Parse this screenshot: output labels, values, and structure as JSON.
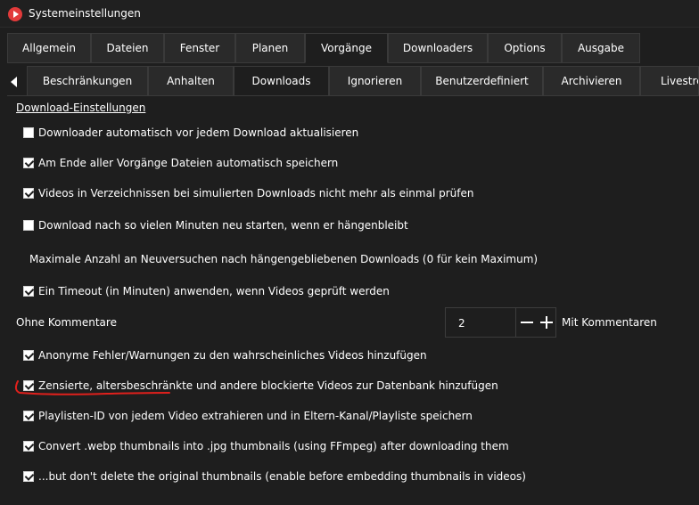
{
  "window": {
    "title": "Systemeinstellungen",
    "icon": "app-play-icon"
  },
  "main_tabs": [
    {
      "label": "Allgemein"
    },
    {
      "label": "Dateien"
    },
    {
      "label": "Fenster"
    },
    {
      "label": "Planen"
    },
    {
      "label": "Vorgänge",
      "active": true
    },
    {
      "label": "Downloaders"
    },
    {
      "label": "Options"
    },
    {
      "label": "Ausgabe"
    }
  ],
  "sub_tabs": [
    {
      "label": "Beschränkungen"
    },
    {
      "label": "Anhalten"
    },
    {
      "label": "Downloads",
      "active": true
    },
    {
      "label": "Ignorieren"
    },
    {
      "label": "Benutzerdefiniert"
    },
    {
      "label": "Archivieren"
    },
    {
      "label": "Livestrea"
    }
  ],
  "section_title": "Download-Einstellungen",
  "options": [
    {
      "label": "Downloader automatisch vor jedem Download aktualisieren",
      "checked": false
    },
    {
      "label": "Am Ende aller Vorgänge Dateien automatisch speichern",
      "checked": true
    },
    {
      "label": "Videos in Verzeichnissen bei simulierten Downloads nicht mehr als einmal prüfen",
      "checked": true
    },
    {
      "label": "Download nach so vielen Minuten neu starten, wenn er hängenbleibt",
      "checked": false
    },
    {
      "label": "Ein Timeout (in Minuten) anwenden, wenn Videos geprüft werden",
      "checked": true
    },
    {
      "label": "Anonyme Fehler/Warnungen zu den wahrscheinliches Videos hinzufügen",
      "checked": true
    },
    {
      "label": "Zensierte, altersbeschränkte und andere blockierte Videos zur Datenbank hinzufügen",
      "checked": true
    },
    {
      "label": "Playlisten-ID von jedem Video extrahieren und in Eltern-Kanal/Playliste speichern",
      "checked": true
    },
    {
      "label": "Convert .webp thumbnails into .jpg thumbnails (using  FFmpeg) after downloading them",
      "checked": true
    },
    {
      "label": "...but don't delete the original thumbnails (enable before embedding thumbnails in videos)",
      "checked": true
    }
  ],
  "max_retries_label": "Maximale Anzahl an Neuversuchen nach hängengebliebenen Downloads (0 für kein Maximum)",
  "comments": {
    "left_label": "Ohne Kommentare",
    "value": "2",
    "right_label": "Mit Kommentaren"
  },
  "annotation": {
    "color": "#e0201c"
  }
}
